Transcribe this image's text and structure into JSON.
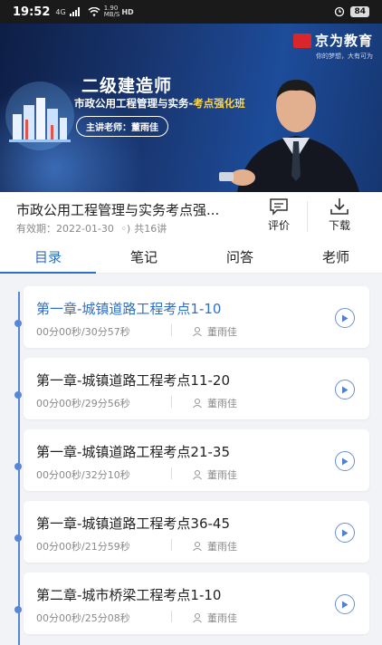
{
  "status": {
    "time": "19:52",
    "signal": "4G",
    "net_speed": "1.90",
    "net_unit": "MB/S",
    "hd": "HD",
    "battery": "84"
  },
  "banner": {
    "brand_name": "京为教育",
    "brand_slogan": "你的梦想，大有可为",
    "title": "二级建造师",
    "subtitle": "市政公用工程管理与实务-",
    "subtitle_highlight": "考点强化班",
    "teacher": "主讲老师：董雨佳"
  },
  "course": {
    "title": "市政公用工程管理与实务考点强...",
    "validity": "有效期：2022-01-30",
    "lessons": "共16讲",
    "review_label": "评价",
    "download_label": "下载"
  },
  "tabs": [
    {
      "label": "目录",
      "active": true
    },
    {
      "label": "笔记"
    },
    {
      "label": "问答"
    },
    {
      "label": "老师"
    }
  ],
  "chapters": [
    {
      "title": "第一章-城镇道路工程考点1-10",
      "duration": "00分00秒/30分57秒",
      "teacher": "董雨佳",
      "current": true
    },
    {
      "title": "第一章-城镇道路工程考点11-20",
      "duration": "00分00秒/29分56秒",
      "teacher": "董雨佳"
    },
    {
      "title": "第一章-城镇道路工程考点21-35",
      "duration": "00分00秒/32分10秒",
      "teacher": "董雨佳"
    },
    {
      "title": "第一章-城镇道路工程考点36-45",
      "duration": "00分00秒/21分59秒",
      "teacher": "董雨佳"
    },
    {
      "title": "第二章-城市桥梁工程考点1-10",
      "duration": "00分00秒/25分08秒",
      "teacher": "董雨佳"
    }
  ],
  "colors": {
    "accent": "#2f6fc4",
    "timeline": "#5a86d6"
  }
}
